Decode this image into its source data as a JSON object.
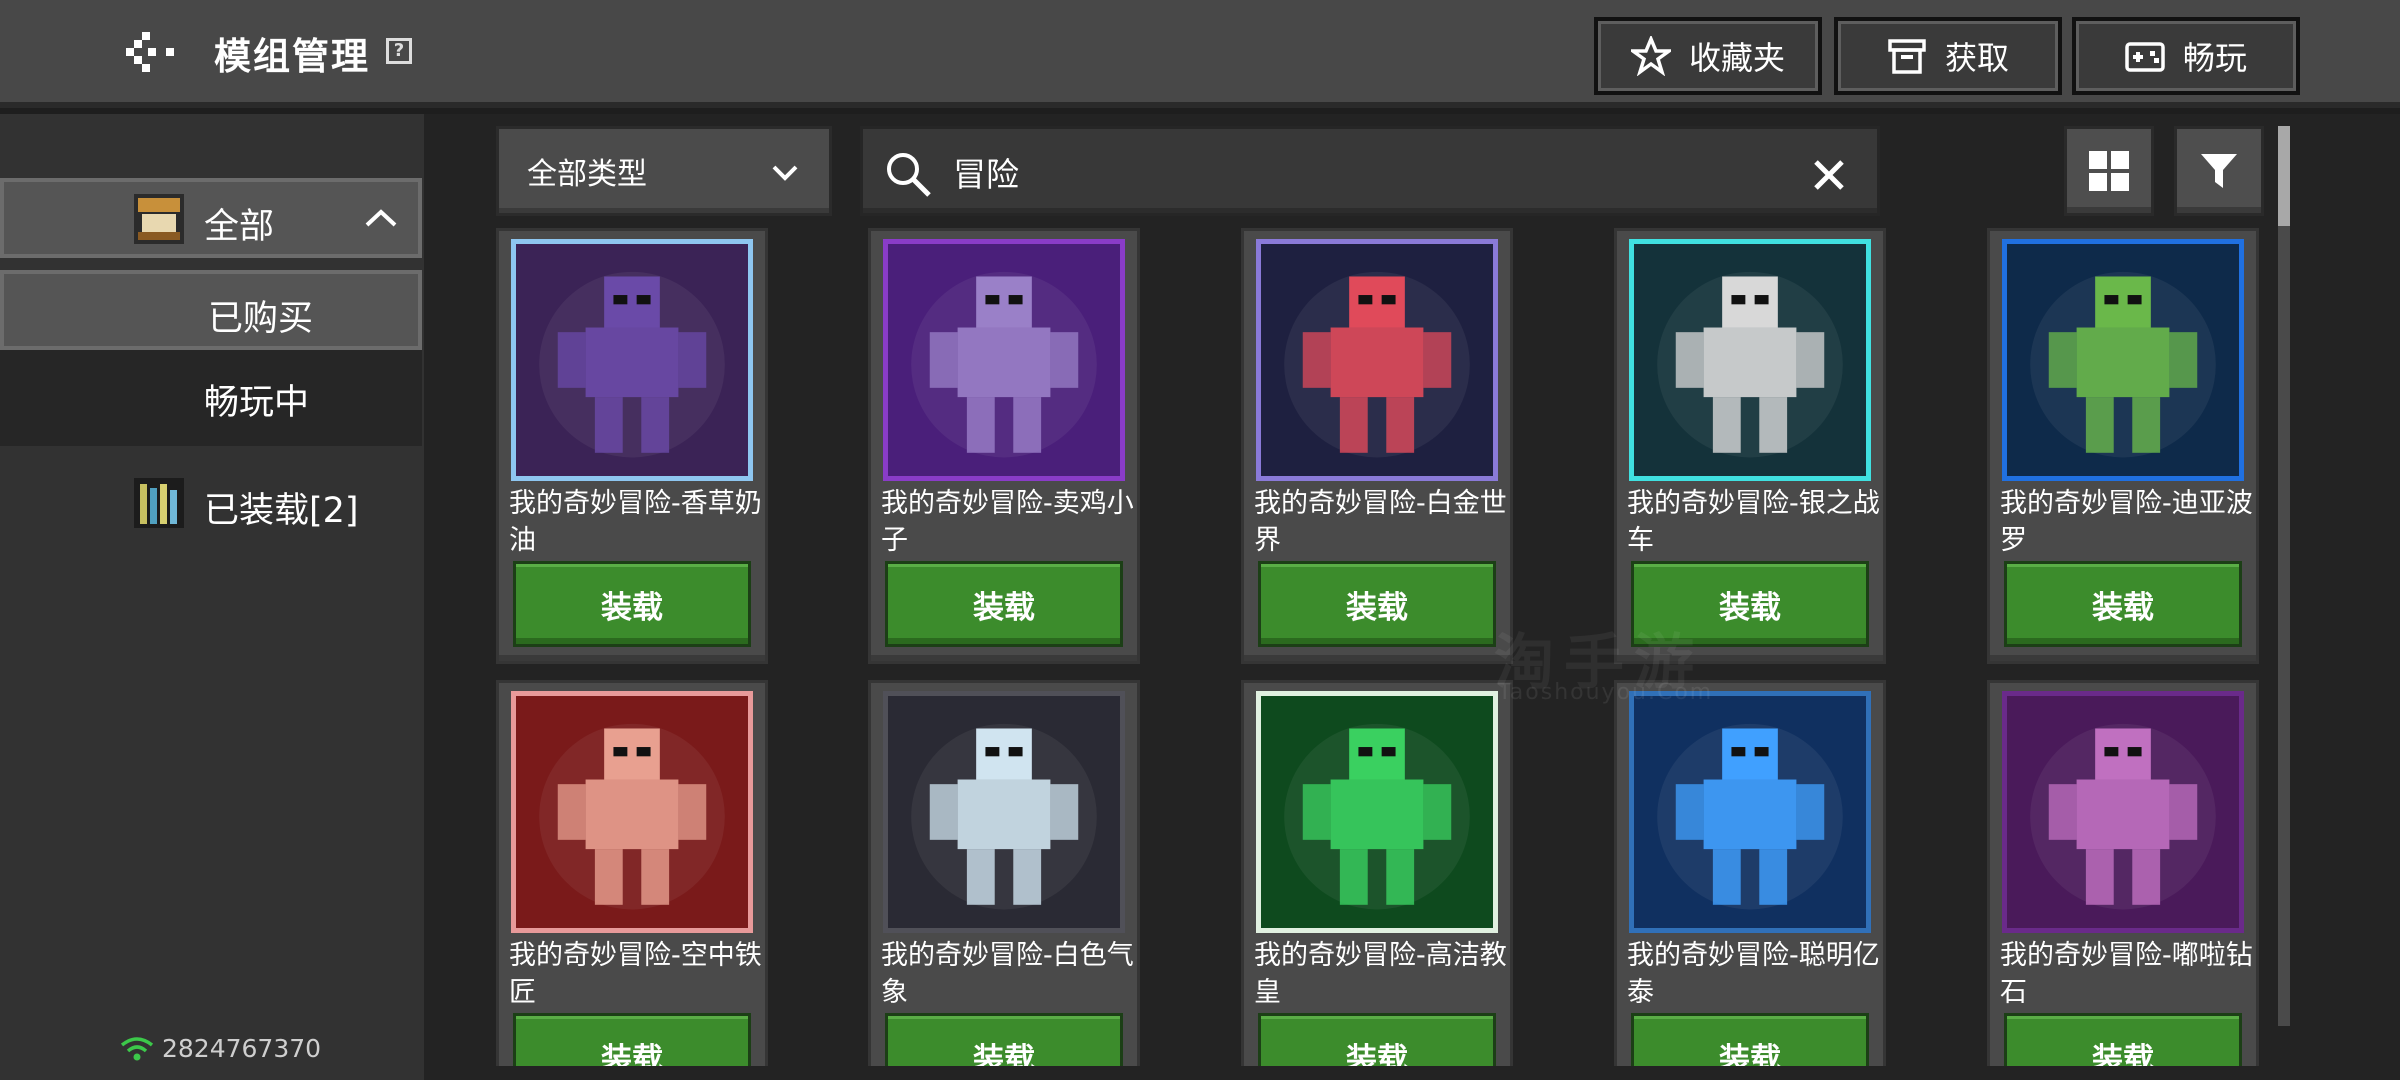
{
  "header": {
    "title": "模组管理",
    "help_label": "?",
    "favorites_label": "收藏夹",
    "obtain_label": "获取",
    "play_label": "畅玩"
  },
  "sidebar": {
    "all_label": "全部",
    "bought_label": "已购买",
    "playing_label": "畅玩中",
    "loaded_label": "已装载[2]",
    "user_id": "2824767370"
  },
  "toolbar": {
    "type_select": "全部类型",
    "search_value": "冒险"
  },
  "watermark": {
    "main": "淘手游",
    "sub": "Taoshouyou.Com"
  },
  "items": [
    {
      "title": "我的奇妙冒险-香草奶油",
      "button": "装载",
      "frame": "#8ec6f0",
      "bg": "#3b2356",
      "figure": "#6a4aa8"
    },
    {
      "title": "我的奇妙冒险-卖鸡小子",
      "button": "装载",
      "frame": "#8a3cc8",
      "bg": "#4a1f7a",
      "figure": "#9a80c8"
    },
    {
      "title": "我的奇妙冒险-白金世界",
      "button": "装载",
      "frame": "#8a7ad8",
      "bg": "#1e2040",
      "figure": "#e04a5a"
    },
    {
      "title": "我的奇妙冒险-银之战车",
      "button": "装载",
      "frame": "#40e0e0",
      "bg": "#14323a",
      "figure": "#d8d8d8"
    },
    {
      "title": "我的奇妙冒险-迪亚波罗",
      "button": "装载",
      "frame": "#2070e0",
      "bg": "#0e2a4a",
      "figure": "#6ab84a"
    },
    {
      "title": "我的奇妙冒险-空中铁匠",
      "button": "装载",
      "frame": "#e89a9a",
      "bg": "#7a1a1a",
      "figure": "#e8a090"
    },
    {
      "title": "我的奇妙冒险-白色气象",
      "button": "装载",
      "frame": "#505058",
      "bg": "#2a2a34",
      "figure": "#d0e4f0"
    },
    {
      "title": " 我的奇妙冒险-高洁教皇",
      "button": "装载",
      "frame": "#e0f0e0",
      "bg": "#0e4a1e",
      "figure": "#3ad060"
    },
    {
      "title": "我的奇妙冒险-聪明亿泰",
      "button": "装载",
      "frame": "#3070b8",
      "bg": "#103060",
      "figure": "#40a0ff"
    },
    {
      "title": "我的奇妙冒险-嘟啦钻石",
      "button": "装载",
      "frame": "#6a2a8a",
      "bg": "#4a1a5a",
      "figure": "#c070c0"
    }
  ]
}
